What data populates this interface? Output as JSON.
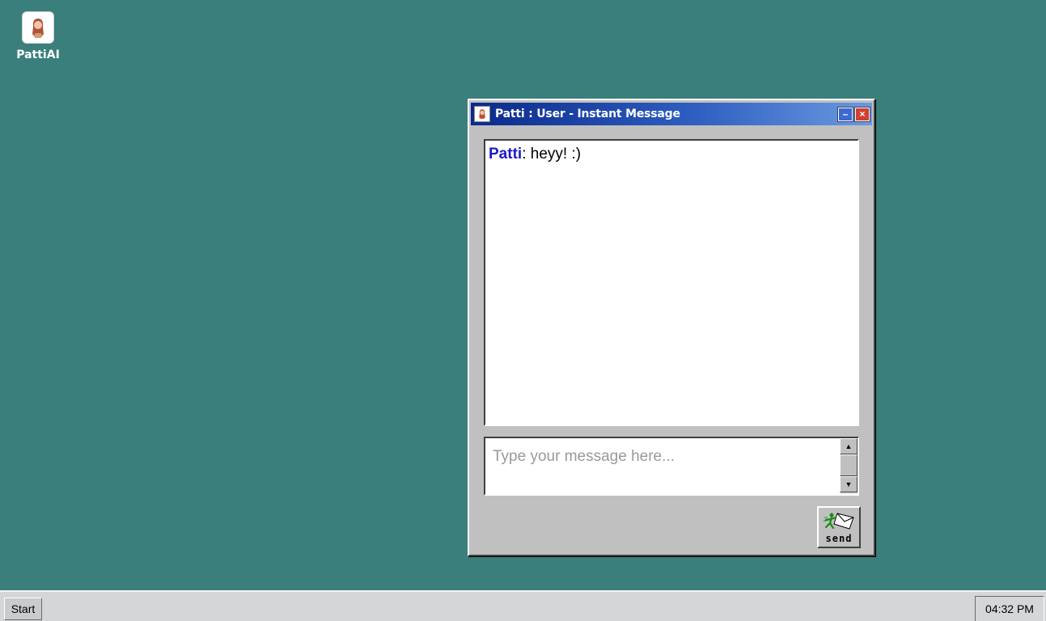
{
  "desktop": {
    "icons": [
      {
        "label": "PattiAI",
        "icon": "patti-avatar-icon"
      }
    ]
  },
  "im_window": {
    "title": "Patti : User - Instant Message",
    "title_icon": "patti-avatar-icon",
    "minimize_label": "–",
    "close_label": "×",
    "messages": [
      {
        "sender": "Patti",
        "separator": ":",
        "text": " heyy! :)"
      }
    ],
    "input": {
      "value": "",
      "placeholder": "Type your message here..."
    },
    "send_label": "send",
    "send_icon": "running-man-envelope-icon"
  },
  "taskbar": {
    "start_label": "Start",
    "clock": "04:32 PM"
  },
  "colors": {
    "desktop": "#3a7f7c",
    "title_bar_start": "#0a2a8a",
    "title_bar_end": "#6a9ae0",
    "sender": "#1a1ac8",
    "window": "#c0c0c0"
  }
}
